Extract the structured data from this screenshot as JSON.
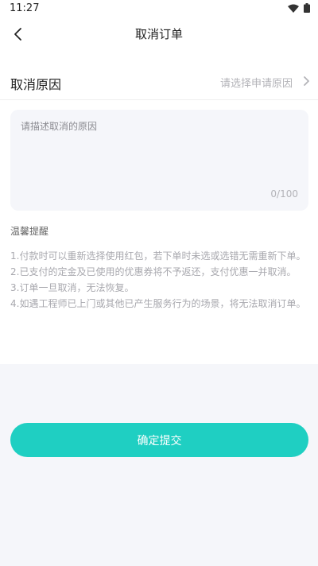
{
  "status_bar": {
    "time": "11:27",
    "icons": [
      "wifi-icon",
      "battery-icon"
    ]
  },
  "header": {
    "title": "取消订单",
    "back_icon": "chevron-left-icon"
  },
  "reason": {
    "label": "取消原因",
    "placeholder": "请选择申请原因",
    "icon": "chevron-right-icon"
  },
  "description": {
    "placeholder": "请描述取消的原因",
    "value": "",
    "counter": "0/100"
  },
  "tips": {
    "title": "温馨提醒",
    "items": [
      "1.付款时可以重新选择使用红包，若下单时未选或选错无需重新下单。",
      "2.已支付的定金及已使用的优惠券将不予返还，支付优惠一并取消。",
      "3.订单一旦取消，无法恢复。",
      "4.如遇工程师已上门或其他已产生服务行为的场景，将无法取消订单。"
    ]
  },
  "submit": {
    "label": "确定提交"
  },
  "colors": {
    "accent": "#1fcfc2",
    "background": "#f5f6fa",
    "panel": "#ffffff",
    "muted_text": "#a8a8ae"
  }
}
